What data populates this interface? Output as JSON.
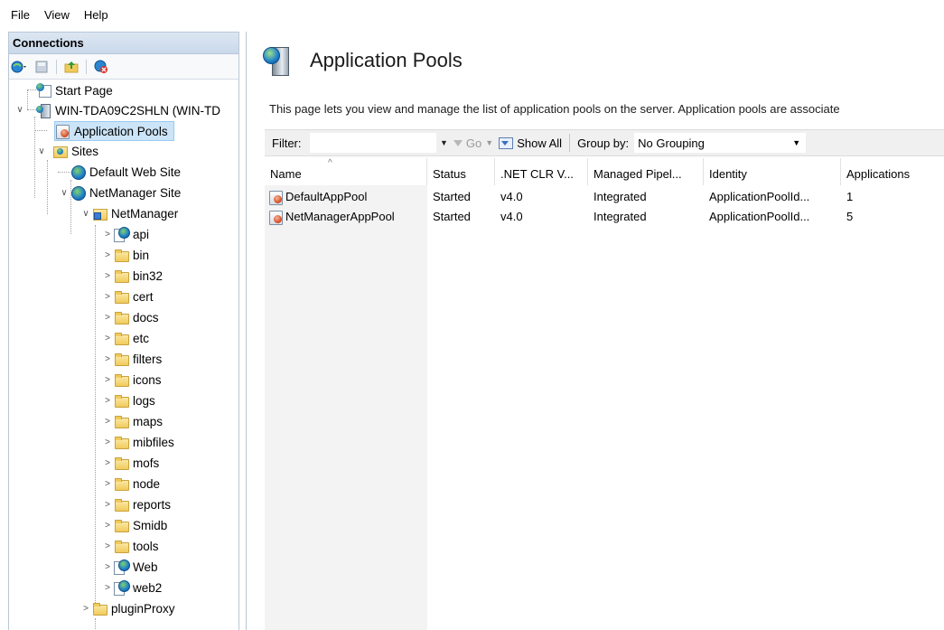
{
  "menu": [
    "File",
    "View",
    "Help"
  ],
  "connections": {
    "title": "Connections"
  },
  "tree": {
    "start_page": "Start Page",
    "server": "WIN-TDA09C2SHLN (WIN-TD",
    "app_pools": "Application Pools",
    "sites": "Sites",
    "default_site": "Default Web Site",
    "netmanager_site": "NetManager Site",
    "netmanager_app": "NetManager",
    "children": [
      "api",
      "bin",
      "bin32",
      "cert",
      "docs",
      "etc",
      "filters",
      "icons",
      "logs",
      "maps",
      "mibfiles",
      "mofs",
      "node",
      "reports",
      "Smidb",
      "tools",
      "Web",
      "web2"
    ],
    "plugin_proxy": "pluginProxy"
  },
  "page": {
    "title": "Application Pools",
    "description": "This page lets you view and manage the list of application pools on the server. Application pools are associate"
  },
  "filter_bar": {
    "filter_label": "Filter:",
    "filter_value": "",
    "go_label": "Go",
    "show_all_label": "Show All",
    "group_by_label": "Group by:",
    "group_by_value": "No Grouping"
  },
  "table": {
    "columns": [
      "Name",
      "Status",
      ".NET CLR V...",
      "Managed Pipel...",
      "Identity",
      "Applications"
    ],
    "rows": [
      [
        "DefaultAppPool",
        "Started",
        "v4.0",
        "Integrated",
        "ApplicationPoolId...",
        "1"
      ],
      [
        "NetManagerAppPool",
        "Started",
        "v4.0",
        "Integrated",
        "ApplicationPoolId...",
        "5"
      ]
    ]
  },
  "colors": {
    "selection": "#cce4f7",
    "header_gradient": "#c9d8ea"
  }
}
